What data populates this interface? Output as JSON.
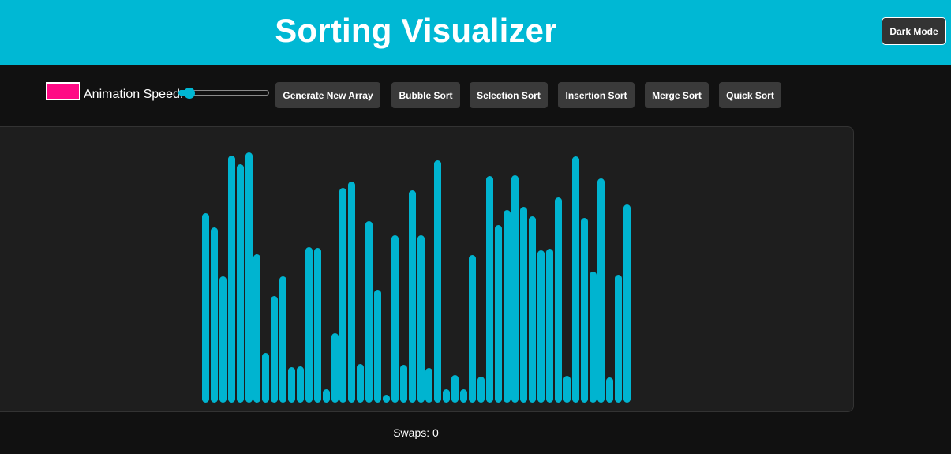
{
  "header": {
    "title": "Sorting Visualizer",
    "dark_mode_label": "Dark Mode"
  },
  "controls": {
    "color_value": "#ff0a85",
    "speed_label": "Animation Speed:",
    "speed_value": 0.12,
    "buttons": [
      "Generate New Array",
      "Bubble Sort",
      "Selection Sort",
      "Insertion Sort",
      "Merge Sort",
      "Quick Sort"
    ]
  },
  "array": {
    "bar_color": "#00b4d0",
    "values": [
      240,
      222,
      160,
      313,
      302,
      317,
      188,
      63,
      135,
      160,
      45,
      46,
      197,
      196,
      17,
      88,
      272,
      280,
      49,
      230,
      143,
      10,
      212,
      48,
      269,
      212,
      44,
      307,
      17,
      35,
      17,
      187,
      33,
      287,
      225,
      244,
      288,
      248,
      236,
      193,
      195,
      260,
      34,
      312,
      234,
      166,
      284,
      32,
      162,
      251
    ]
  },
  "status": {
    "swaps_text": "Swaps: 0"
  },
  "colors": {
    "header_bg": "#00b8d4",
    "page_bg": "#111111",
    "panel_bg": "#1e1e1e",
    "button_bg": "#3a3a3a"
  }
}
